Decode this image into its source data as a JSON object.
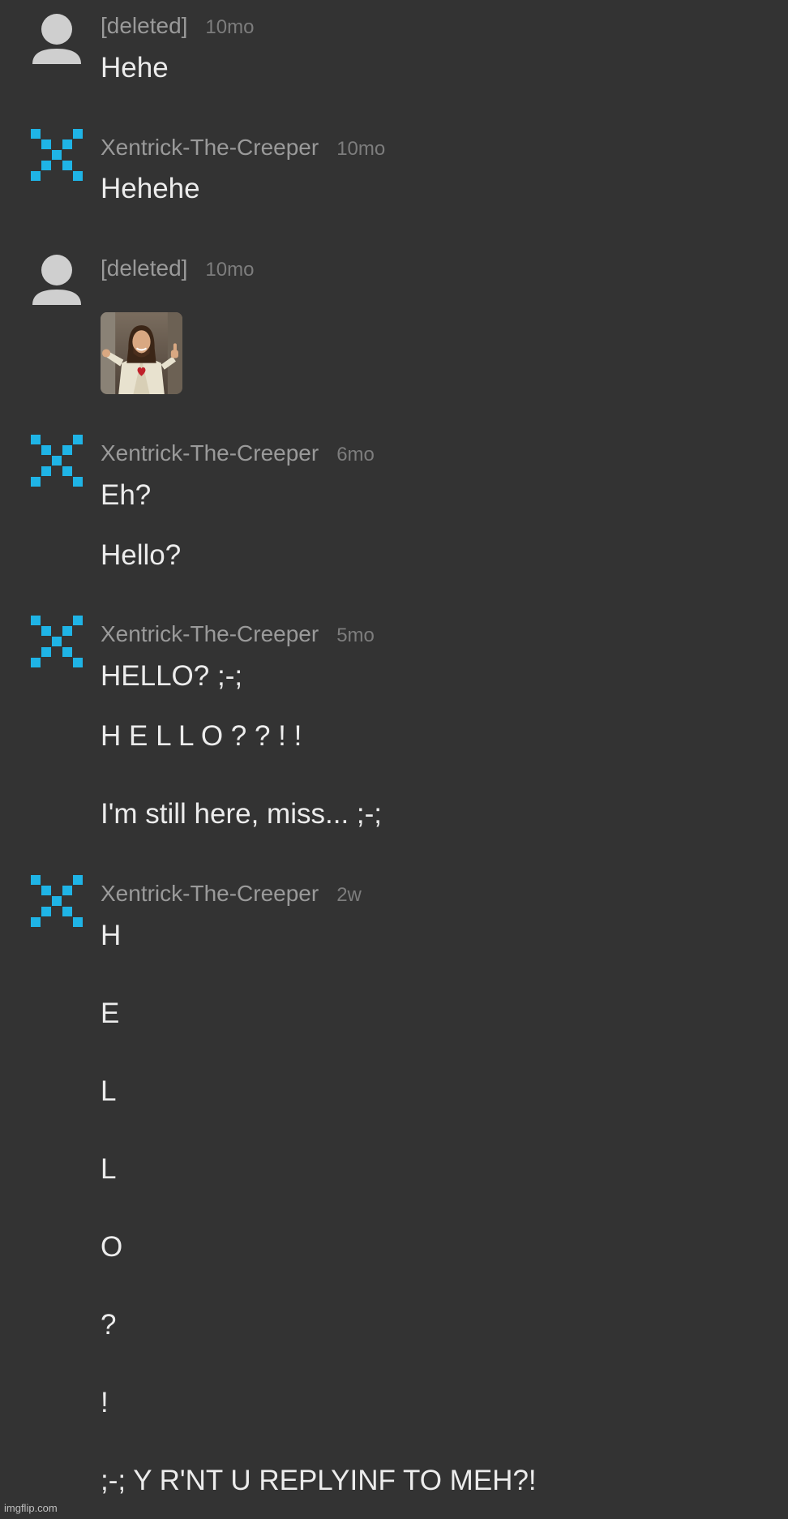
{
  "comments": [
    {
      "author": "[deleted]",
      "time": "10mo",
      "lines": [
        "Hehe"
      ]
    },
    {
      "author": "Xentrick-The-Creeper",
      "time": "10mo",
      "lines": [
        "Hehehe"
      ]
    },
    {
      "author": "[deleted]",
      "time": "10mo",
      "image": "buddy-christ-thumbs-up-thumbnail"
    },
    {
      "author": "Xentrick-The-Creeper",
      "time": "6mo",
      "lines": [
        "Eh?",
        "Hello?"
      ]
    },
    {
      "author": "Xentrick-The-Creeper",
      "time": "5mo",
      "lines": [
        "HELLO? ;-;",
        "H E L L O ? ? ! !",
        "I'm still here, miss... ;-;"
      ]
    },
    {
      "author": "Xentrick-The-Creeper",
      "time": "2w",
      "lines": [
        "H",
        "E",
        "L",
        "L",
        "O",
        "?",
        "!",
        ";-; Y R'NT U REPLYINF TO MEH?!"
      ]
    }
  ],
  "icons": {
    "deleted_avatar": "default-user-avatar-icon",
    "user_avatar": "checkered-x-avatar-icon"
  },
  "colors": {
    "background": "#333333",
    "avatar_blue": "#1fb4e6",
    "deleted_avatar": "#cfcfcf"
  },
  "watermark": "imgflip.com"
}
